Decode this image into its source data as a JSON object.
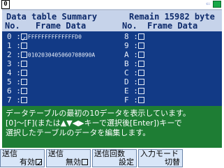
{
  "window": {
    "number": "0"
  },
  "header": {
    "title": "Data table Summary",
    "remain": "Remain 15982 byte",
    "col_no_left": "No.",
    "col_frame_left": "Frame Data",
    "col_no_right": "No.",
    "col_frame_right": "Frame Data"
  },
  "rows_left": [
    {
      "no": "0",
      "sep": ":",
      "checked": true,
      "data": "FFFFFFFFFFFFFFD0"
    },
    {
      "no": "1",
      "sep": ":",
      "checked": false,
      "data": ""
    },
    {
      "no": "2",
      "sep": ":",
      "checked": false,
      "data": "0102030405060708090A"
    },
    {
      "no": "3",
      "sep": ":",
      "checked": false,
      "data": ""
    },
    {
      "no": "4",
      "sep": ":",
      "checked": false,
      "data": ""
    },
    {
      "no": "5",
      "sep": ":",
      "checked": false,
      "data": ""
    },
    {
      "no": "6",
      "sep": ":",
      "checked": false,
      "data": ""
    },
    {
      "no": "7",
      "sep": ":",
      "checked": false,
      "data": ""
    }
  ],
  "rows_right": [
    {
      "no": "8",
      "sep": ":",
      "checked": false,
      "data": ""
    },
    {
      "no": "9",
      "sep": ":",
      "checked": false,
      "data": ""
    },
    {
      "no": "A",
      "sep": ":",
      "checked": false,
      "data": ""
    },
    {
      "no": "B",
      "sep": ":",
      "checked": false,
      "data": ""
    },
    {
      "no": "C",
      "sep": ":",
      "checked": false,
      "data": ""
    },
    {
      "no": "D",
      "sep": ":",
      "checked": false,
      "data": ""
    },
    {
      "no": "E",
      "sep": ":",
      "checked": false,
      "data": ""
    },
    {
      "no": "F",
      "sep": ":",
      "checked": false,
      "data": ""
    }
  ],
  "help": {
    "line1": "データテーブルの最初の10データを表示しています。",
    "line2": "[0]～[F](または▲▼◀▶キーで選択後[Enter])キーで",
    "line3": "選択したテーブルのデータを編集します。"
  },
  "softkeys": [
    {
      "top": "送信",
      "bottom": "有効",
      "checked": true
    },
    {
      "top": "送信",
      "bottom": "無効",
      "checked": false
    },
    {
      "top": "送信回数",
      "bottom": "設定"
    },
    {
      "top": "入力モード",
      "bottom": "切替"
    }
  ],
  "colors": {
    "panel": "#123a86",
    "header": "#c6d3ea",
    "help": "#1e7d34",
    "softkey": "#d8e6f8",
    "battery": "#18a848"
  },
  "icons": {
    "status_arrow": "arrow-icon",
    "battery": "battery-icon"
  }
}
